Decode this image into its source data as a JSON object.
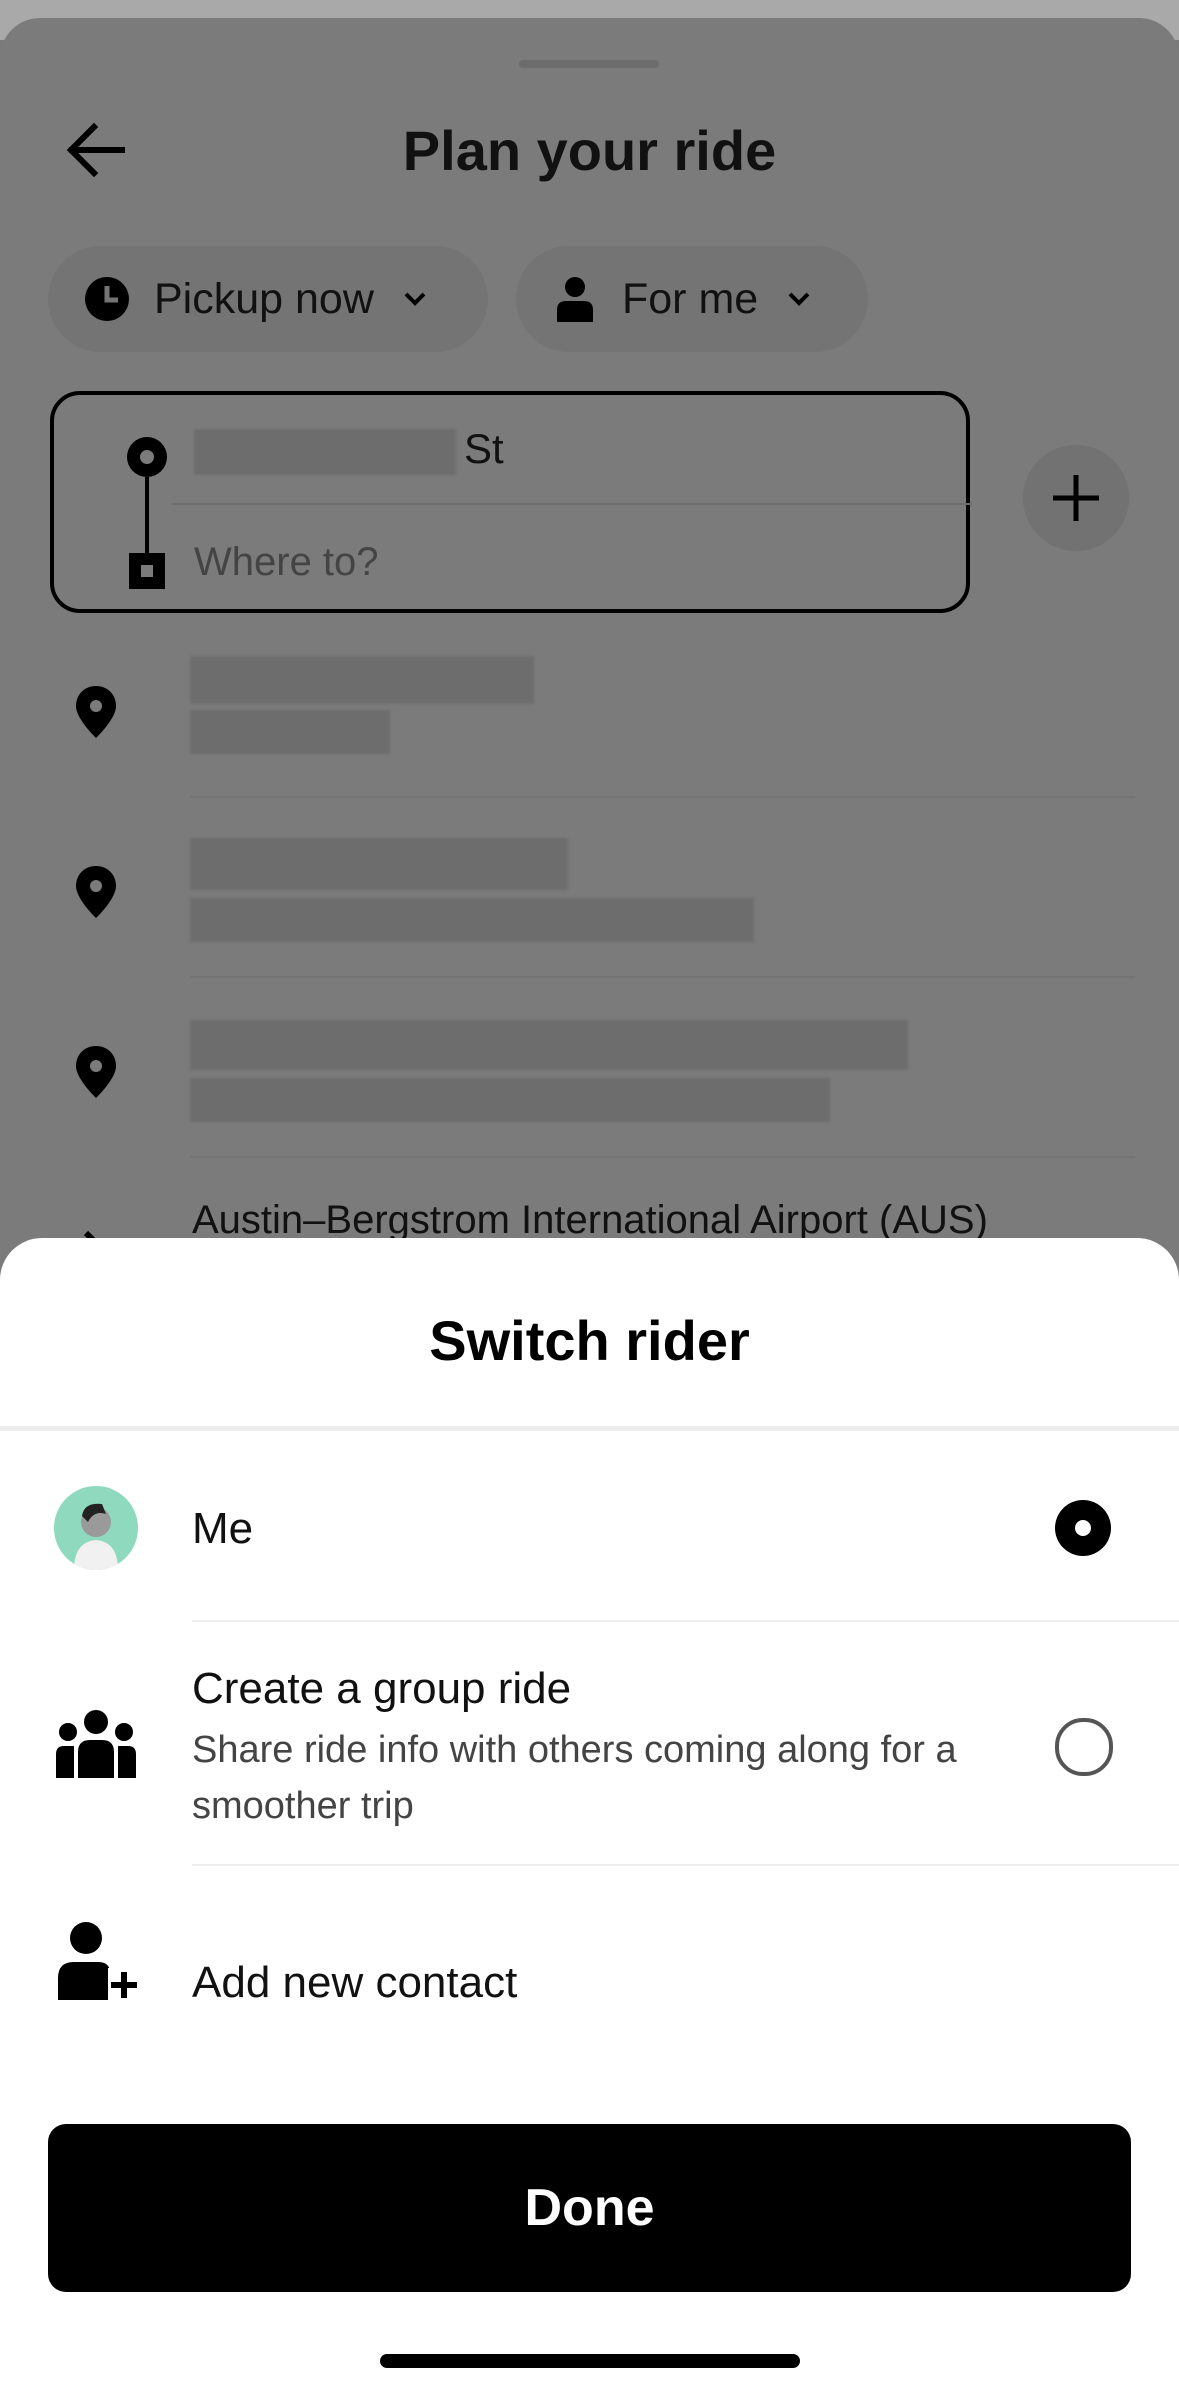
{
  "header": {
    "title": "Plan your ride"
  },
  "chips": {
    "pickup_label": "Pickup now",
    "rider_label": "For me"
  },
  "route": {
    "pickup_suffix": "St",
    "destination_placeholder": "Where to?"
  },
  "recent": {
    "airport_name": "Austin–Bergstrom International Airport (AUS)"
  },
  "modal": {
    "title": "Switch rider",
    "options": [
      {
        "label": "Me",
        "selected": true
      },
      {
        "label": "Create a group ride",
        "sublabel": "Share ride info with others coming along for a smoother trip",
        "selected": false
      },
      {
        "label": "Add new contact"
      }
    ],
    "done_label": "Done"
  },
  "colors": {
    "avatar_bg": "#8fd9bf",
    "scrim": "#7a7a7a",
    "button": "#000000"
  },
  "icons": [
    "back-arrow-icon",
    "clock-icon",
    "person-icon",
    "chevron-down-icon",
    "plus-icon",
    "location-pin-icon",
    "group-icon",
    "add-person-icon",
    "avatar"
  ]
}
